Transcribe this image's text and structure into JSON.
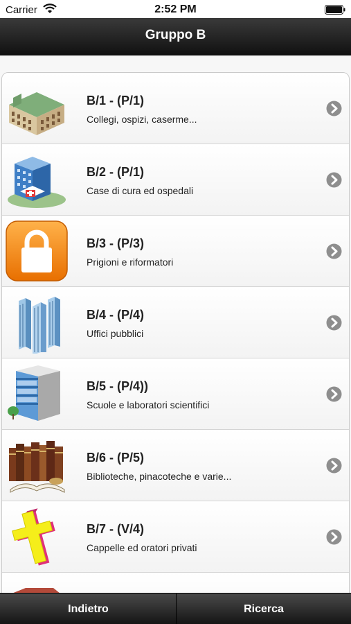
{
  "status": {
    "carrier": "Carrier",
    "time": "2:52 PM"
  },
  "nav": {
    "title": "Gruppo B"
  },
  "items": [
    {
      "code": "B/1 - (P/1)",
      "desc": "Collegi, ospizi, caserme...",
      "icon": "historic-building-icon"
    },
    {
      "code": "B/2 - (P/1)",
      "desc": "Case di cura ed ospedali",
      "icon": "hospital-icon"
    },
    {
      "code": "B/3 - (P/3)",
      "desc": "Prigioni e riformatori",
      "icon": "padlock-icon"
    },
    {
      "code": "B/4 - (P/4)",
      "desc": "Uffici pubblici",
      "icon": "office-towers-icon"
    },
    {
      "code": "B/5 - (P/4))",
      "desc": "Scuole e laboratori scientifici",
      "icon": "school-building-icon"
    },
    {
      "code": "B/6 - (P/5)",
      "desc": "Biblioteche, pinacoteche e varie...",
      "icon": "library-books-icon"
    },
    {
      "code": "B/7 - (V/4)",
      "desc": "Cappelle ed oratori privati",
      "icon": "cross-icon"
    }
  ],
  "tabs": {
    "back_label": "Indietro",
    "search_label": "Ricerca"
  },
  "colors": {
    "nav_bg": "#1a1a1a",
    "chevron": "#8e8e8e",
    "padlock_orange": "#f08a00",
    "cross_yellow": "#f5ee1a",
    "cross_pink": "#e0307a"
  }
}
